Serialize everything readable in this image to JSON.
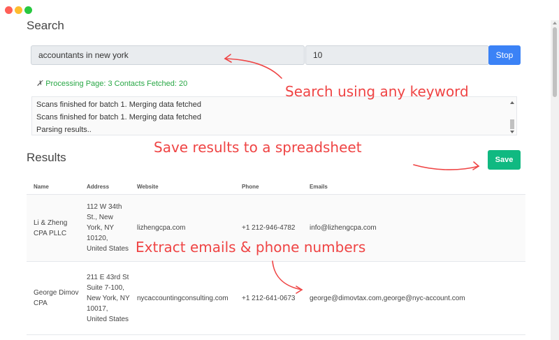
{
  "window": {
    "buttons": [
      "close",
      "minimize",
      "maximize"
    ]
  },
  "search": {
    "title": "Search",
    "keyword_value": "accountants in new york",
    "count_value": "10",
    "stop_label": "Stop",
    "status_icon": "x-icon",
    "status_text": "Processing Page: 3 Contacts Fetched: 20",
    "log_lines": [
      "Scans finished for batch 1. Merging data fetched",
      "Scans finished for batch 1. Merging data fetched",
      "Parsing results.."
    ]
  },
  "results": {
    "title": "Results",
    "save_label": "Save",
    "columns": [
      "Name",
      "Address",
      "Website",
      "Phone",
      "Emails"
    ],
    "rows": [
      {
        "name": "Li & Zheng CPA PLLC",
        "address": "112 W 34th St., New York, NY 10120, United States",
        "website": "lizhengcpa.com",
        "phone": "+1 212-946-4782",
        "emails": "info@lizhengcpa.com"
      },
      {
        "name": "George Dimov CPA",
        "address": "211 E 43rd St Suite 7-100, New York, NY 10017, United States",
        "website": "nycaccountingconsulting.com",
        "phone": "+1 212-641-0673",
        "emails": "george@dimovtax.com,george@nyc-account.com"
      }
    ]
  },
  "annotations": {
    "search": "Search using any keyword",
    "save": "Save results to a spreadsheet",
    "extract": "Extract emails & phone numbers"
  },
  "colors": {
    "stop_button": "#3b82f6",
    "save_button": "#10b981",
    "status_text": "#28a745",
    "annotation": "#ef4444"
  }
}
